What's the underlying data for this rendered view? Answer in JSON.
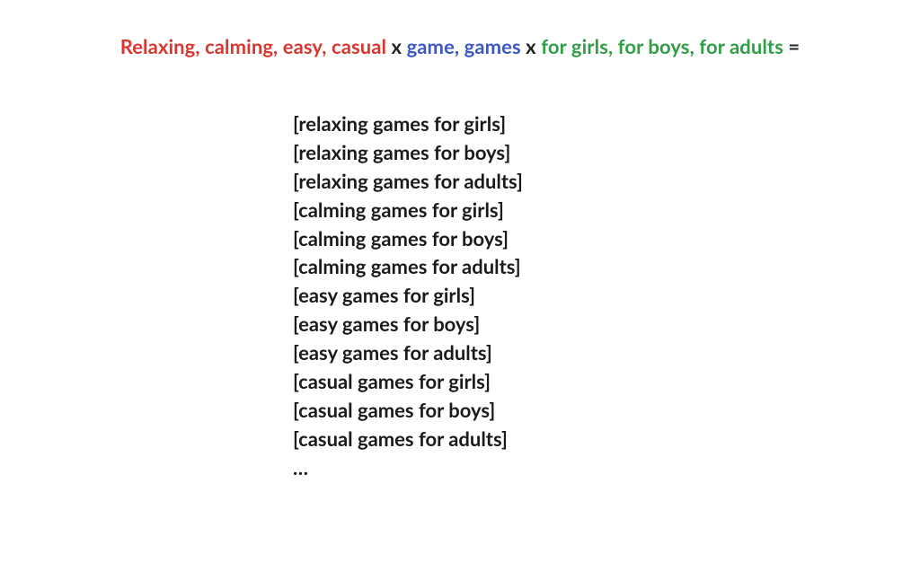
{
  "formula": {
    "group1": "Relaxing, calming, easy, casual",
    "sep1": " x ",
    "group2": "game, games",
    "sep2": " x ",
    "group3": "for girls, for boys, for adults",
    "equals": " ="
  },
  "results": [
    "[relaxing games for girls]",
    "[relaxing games for boys]",
    "[relaxing games for adults]",
    "[calming games for girls]",
    "[calming games for boys]",
    "[calming games for adults]",
    "[easy games for girls]",
    "[easy games for boys]",
    "[easy games for adults]",
    "[casual games for girls]",
    "[casual games for boys]",
    "[casual games for adults]",
    "…"
  ]
}
